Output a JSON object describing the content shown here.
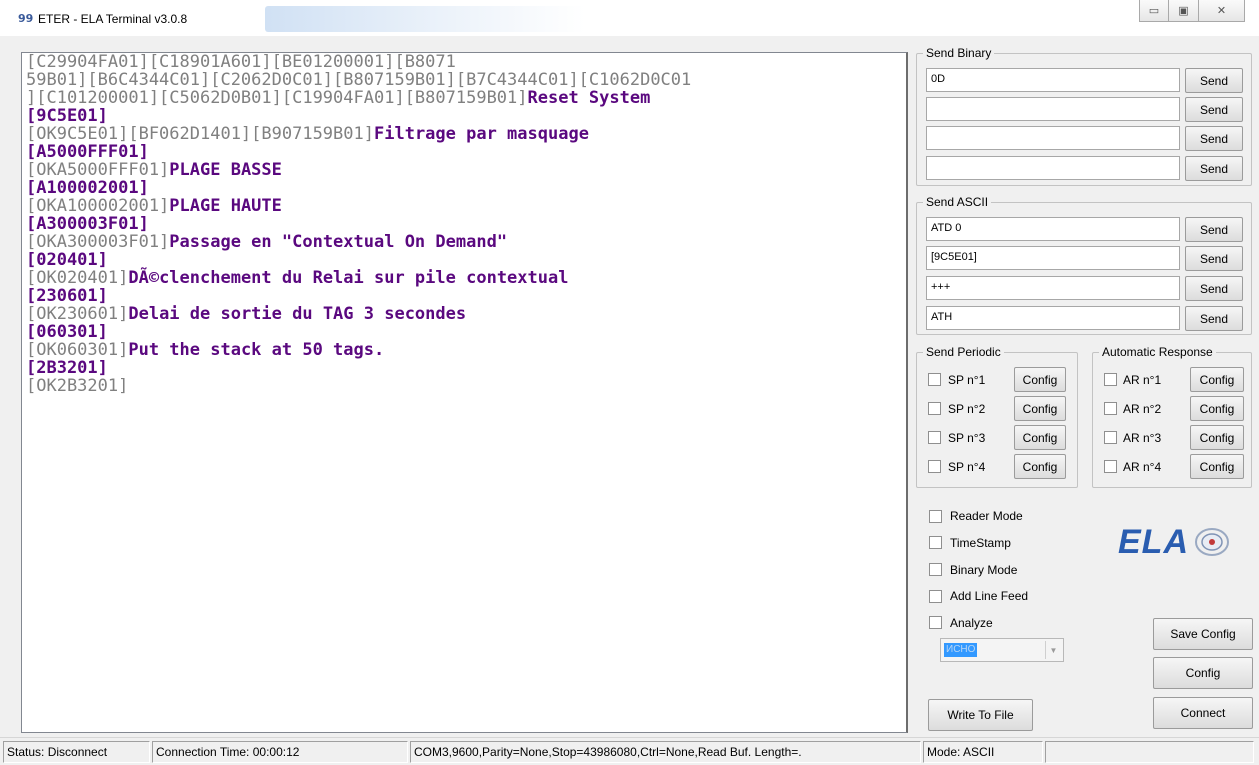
{
  "window": {
    "title": "ETER - ELA Terminal v3.0.8",
    "app_icon_glyph": "99",
    "minimize_glyph": "▭",
    "maximize_glyph": "▣",
    "close_glyph": "✕"
  },
  "terminal": {
    "lines": [
      [
        {
          "t": "[C29904FA01][C18901A601][BE01200001][B8071",
          "s": "echo"
        }
      ],
      [
        {
          "t": "59B01][B6C4344C01][C2062D0C01][B807159B01][B7C4344C01][C1062D0C01",
          "s": "echo"
        }
      ],
      [
        {
          "t": "][C101200001][C5062D0B01][C19904FA01][B807159B01]",
          "s": "echo"
        },
        {
          "t": "Reset System",
          "s": "resp"
        }
      ],
      [
        {
          "t": "[9C5E01]",
          "s": "cmd"
        }
      ],
      [
        {
          "t": "[OK9C5E01][BF062D1401][B907159B01]",
          "s": "echo"
        },
        {
          "t": "Filtrage par masquage",
          "s": "resp"
        }
      ],
      [
        {
          "t": "[A5000FFF01]",
          "s": "cmd"
        }
      ],
      [
        {
          "t": "[OKA5000FFF01]",
          "s": "echo"
        },
        {
          "t": "PLAGE BASSE",
          "s": "resp"
        }
      ],
      [
        {
          "t": "[A100002001]",
          "s": "cmd"
        }
      ],
      [
        {
          "t": "[OKA100002001]",
          "s": "echo"
        },
        {
          "t": "PLAGE HAUTE",
          "s": "resp"
        }
      ],
      [
        {
          "t": "[A300003F01]",
          "s": "cmd"
        }
      ],
      [
        {
          "t": "[OKA300003F01]",
          "s": "echo"
        },
        {
          "t": "Passage en \"Contextual On Demand\"",
          "s": "resp"
        }
      ],
      [
        {
          "t": "[020401]",
          "s": "cmd"
        }
      ],
      [
        {
          "t": "[OK020401]",
          "s": "echo"
        },
        {
          "t": "DÃ©clenchement du Relai sur pile contextual",
          "s": "resp"
        }
      ],
      [
        {
          "t": "[230601]",
          "s": "cmd"
        }
      ],
      [
        {
          "t": "[OK230601]",
          "s": "echo"
        },
        {
          "t": "Delai de sortie du TAG 3 secondes",
          "s": "resp"
        }
      ],
      [
        {
          "t": "[060301]",
          "s": "cmd"
        }
      ],
      [
        {
          "t": "[OK060301]",
          "s": "echo"
        },
        {
          "t": "Put the stack at 50 tags.",
          "s": "resp"
        }
      ],
      [
        {
          "t": "[2B3201]",
          "s": "cmd"
        }
      ],
      [
        {
          "t": "[OK2B3201]",
          "s": "echo"
        }
      ]
    ]
  },
  "send_binary": {
    "label": "Send Binary",
    "rows": [
      {
        "value": "0D",
        "button": "Send"
      },
      {
        "value": "",
        "button": "Send"
      },
      {
        "value": "",
        "button": "Send"
      },
      {
        "value": "",
        "button": "Send"
      }
    ]
  },
  "send_ascii": {
    "label": "Send ASCII",
    "rows": [
      {
        "value": "ATD 0",
        "button": "Send"
      },
      {
        "value": "[9C5E01]",
        "button": "Send"
      },
      {
        "value": "+++",
        "button": "Send"
      },
      {
        "value": "ATH",
        "button": "Send"
      }
    ]
  },
  "send_periodic": {
    "label": "Send Periodic",
    "rows": [
      {
        "label": "SP n°1",
        "button": "Config",
        "checked": false
      },
      {
        "label": "SP n°2",
        "button": "Config",
        "checked": false
      },
      {
        "label": "SP n°3",
        "button": "Config",
        "checked": false
      },
      {
        "label": "SP n°4",
        "button": "Config",
        "checked": false
      }
    ]
  },
  "auto_response": {
    "label": "Automatic Response",
    "rows": [
      {
        "label": "AR n°1",
        "button": "Config",
        "checked": false
      },
      {
        "label": "AR n°2",
        "button": "Config",
        "checked": false
      },
      {
        "label": "AR n°3",
        "button": "Config",
        "checked": false
      },
      {
        "label": "AR n°4",
        "button": "Config",
        "checked": false
      }
    ]
  },
  "options": [
    {
      "label": "Reader Mode",
      "checked": false
    },
    {
      "label": "TimeStamp",
      "checked": false
    },
    {
      "label": "Binary Mode",
      "checked": false
    },
    {
      "label": "Add Line Feed",
      "checked": false
    },
    {
      "label": "Analyze",
      "checked": false
    }
  ],
  "analyze_select": {
    "value": "ИСНО"
  },
  "buttons": {
    "save_config": "Save Config",
    "config": "Config",
    "connect": "Connect",
    "write_to_file": "Write To File"
  },
  "logo": {
    "text": "ELA",
    "color": "#2a5db0"
  },
  "status": {
    "status": "Status: Disconnect",
    "connection_time": "Connection Time: 00:00:12",
    "com": "COM3,9600,Parity=None,Stop=43986080,Ctrl=None,Read Buf. Length=.",
    "mode": "Mode: ASCII",
    "extra": ""
  },
  "colors": {
    "echo": "#808080",
    "response": "#5a087f"
  }
}
